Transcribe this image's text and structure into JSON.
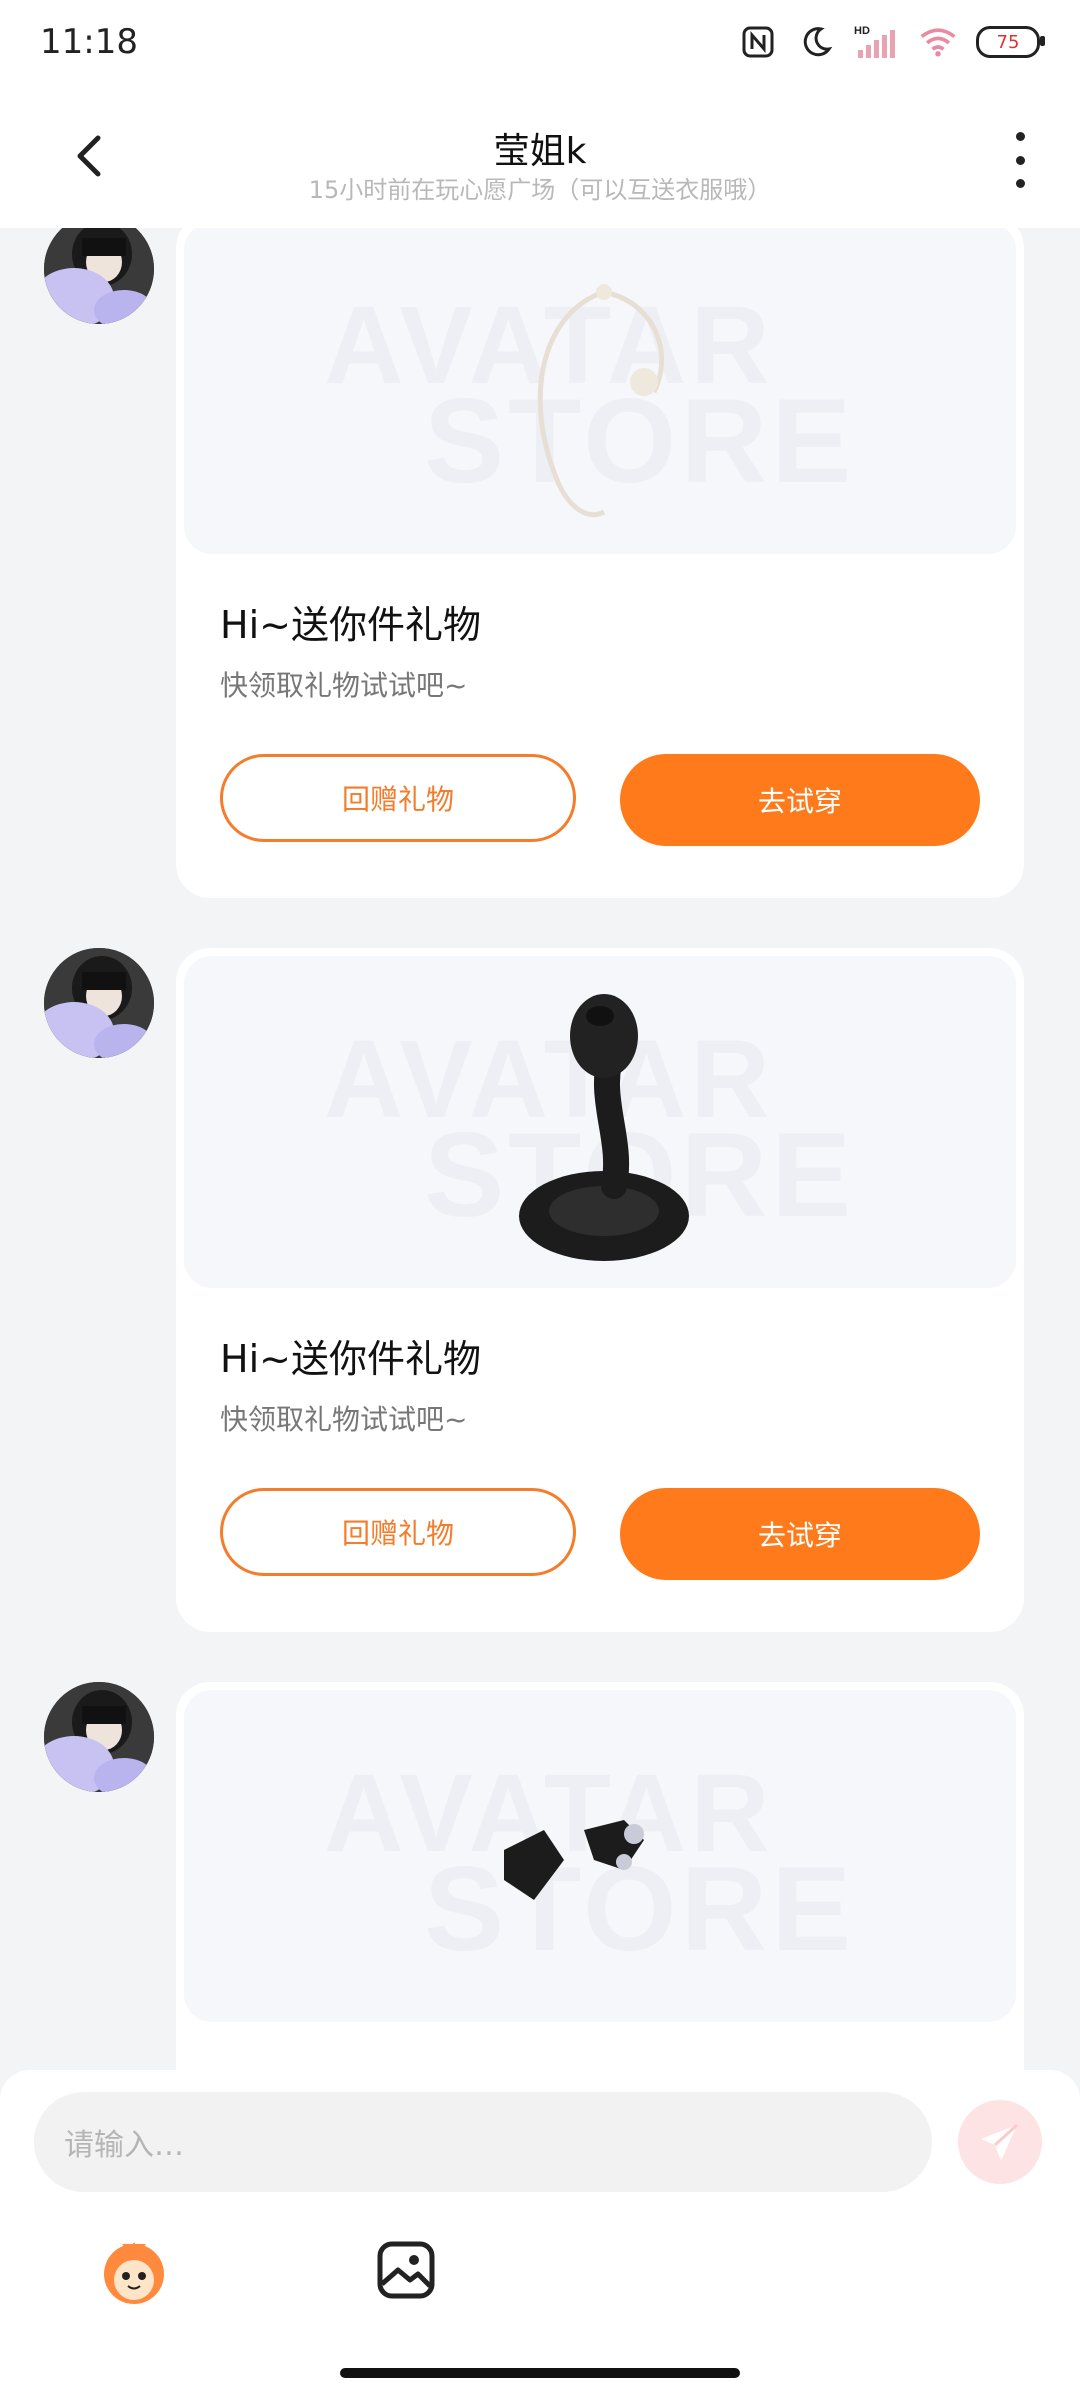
{
  "status": {
    "time": "11:18",
    "battery": "75",
    "network": "HD"
  },
  "header": {
    "title": "莹姐k",
    "subtitle": "15小时前在玩心愿广场（可以互送衣服哦）"
  },
  "messages": [
    {
      "title": "Hi~送你件礼物",
      "subtitle": "快领取礼物试试吧~",
      "btn_return": "回赠礼物",
      "btn_try": "去试穿",
      "gift": "necklace",
      "watermark_1": "AVATAR",
      "watermark_2": "STORE"
    },
    {
      "title": "Hi~送你件礼物",
      "subtitle": "快领取礼物试试吧~",
      "btn_return": "回赠礼物",
      "btn_try": "去试穿",
      "gift": "cobra",
      "watermark_1": "AVATAR",
      "watermark_2": "STORE"
    },
    {
      "gift": "gloves",
      "watermark_1": "AVATAR",
      "watermark_2": "STORE"
    }
  ],
  "input": {
    "placeholder": "请输入…"
  },
  "colors": {
    "accent": "#ff7a1a",
    "outline": "#f47c2a",
    "background": "#f3f4f6"
  }
}
